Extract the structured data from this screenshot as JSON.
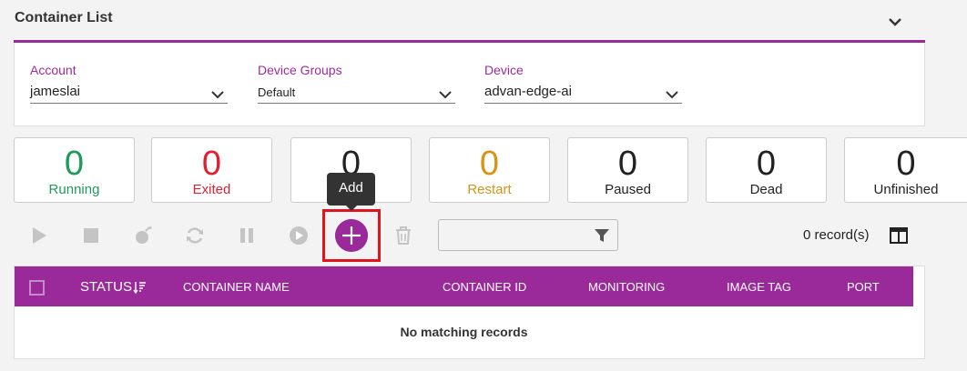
{
  "panel": {
    "title": "Container List"
  },
  "filters": [
    {
      "label": "Account",
      "value": "jameslai"
    },
    {
      "label": "Device Groups",
      "value": "Default"
    },
    {
      "label": "Device",
      "value": "advan-edge-ai"
    }
  ],
  "stats": [
    {
      "count": "0",
      "label": "Running",
      "color": "#1e9a5a"
    },
    {
      "count": "0",
      "label": "Exited",
      "color": "#e02030"
    },
    {
      "count": "0",
      "label": "",
      "color": "#222222"
    },
    {
      "count": "0",
      "label": "Restart",
      "color": "#d79316"
    },
    {
      "count": "0",
      "label": "Paused",
      "color": "#222222"
    },
    {
      "count": "0",
      "label": "Dead",
      "color": "#222222"
    },
    {
      "count": "0",
      "label": "Unfinished",
      "color": "#222222"
    }
  ],
  "tooltip": {
    "text": "Add"
  },
  "toolbar": {
    "icons": [
      "play-icon",
      "stop-icon",
      "kill-icon",
      "restart-icon",
      "pause-icon",
      "resume-icon",
      "add-icon",
      "delete-icon"
    ],
    "search_value": "",
    "records_text": "0 record(s)"
  },
  "table": {
    "columns": [
      "STATUS",
      "CONTAINER NAME",
      "CONTAINER ID",
      "MONITORING",
      "IMAGE TAG",
      "PORT"
    ],
    "empty_text": "No matching records"
  },
  "colors": {
    "accent": "#9a2a9a",
    "highlight": "#e0141e"
  }
}
